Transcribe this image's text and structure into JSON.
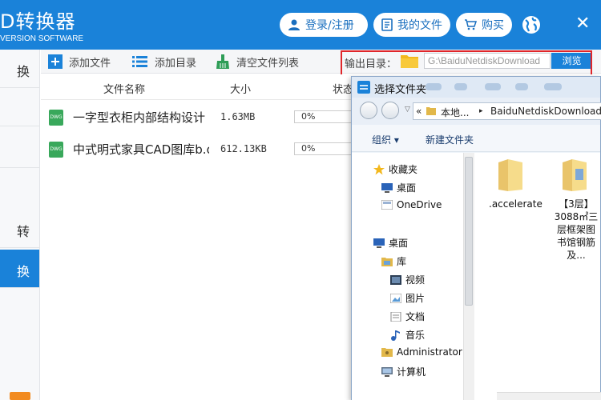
{
  "header": {
    "title": "D转换器",
    "subtitle": "VERSION SOFTWARE",
    "login_label": "登录/注册",
    "my_files_label": "我的文件",
    "buy_label": "购买",
    "accent_color": "#1a82d9"
  },
  "sidebar": {
    "items": [
      {
        "label": "换",
        "active": false
      },
      {
        "label": "",
        "active": false
      },
      {
        "label": "",
        "active": false
      },
      {
        "label": "转",
        "active": false
      },
      {
        "label": "换",
        "active": true
      }
    ]
  },
  "toolbar": {
    "add_file_label": "添加文件",
    "add_dir_label": "添加目录",
    "clear_label": "清空文件列表",
    "output_dir_label": "输出目录：",
    "output_path": "G:\\BaiduNetdiskDownload",
    "browse_label": "浏览"
  },
  "table": {
    "headers": {
      "name": "文件名称",
      "size": "大小",
      "status": "状态"
    },
    "rows": [
      {
        "icon": "dwg",
        "icon_text": "DWG",
        "name": "一字型衣柜内部结构设计",
        "size": "1.63MB",
        "progress": "0%"
      },
      {
        "icon": "dwg",
        "icon_text": "DWG",
        "name": "中式明式家具CAD图库b.dwg",
        "size": "612.13KB",
        "progress": "0%"
      }
    ]
  },
  "dialog": {
    "title": "选择文件夹",
    "address": {
      "prefix": "«",
      "part1": "本地...",
      "separator": "▸",
      "part2": "BaiduNetdiskDownload"
    },
    "organize_label": "组织 ▾",
    "new_folder_label": "新建文件夹",
    "tree": {
      "favorites": "收藏夹",
      "desktop_fav": "桌面",
      "onedrive": "OneDrive",
      "desktop": "桌面",
      "library": "库",
      "videos": "视频",
      "pictures": "图片",
      "documents": "文档",
      "music": "音乐",
      "administrator": "Administrator",
      "computer": "计算机"
    },
    "files": [
      {
        "name": ".accelerate"
      },
      {
        "name": "【3层】3088㎡三层框架图书馆钢筋及..."
      }
    ]
  }
}
